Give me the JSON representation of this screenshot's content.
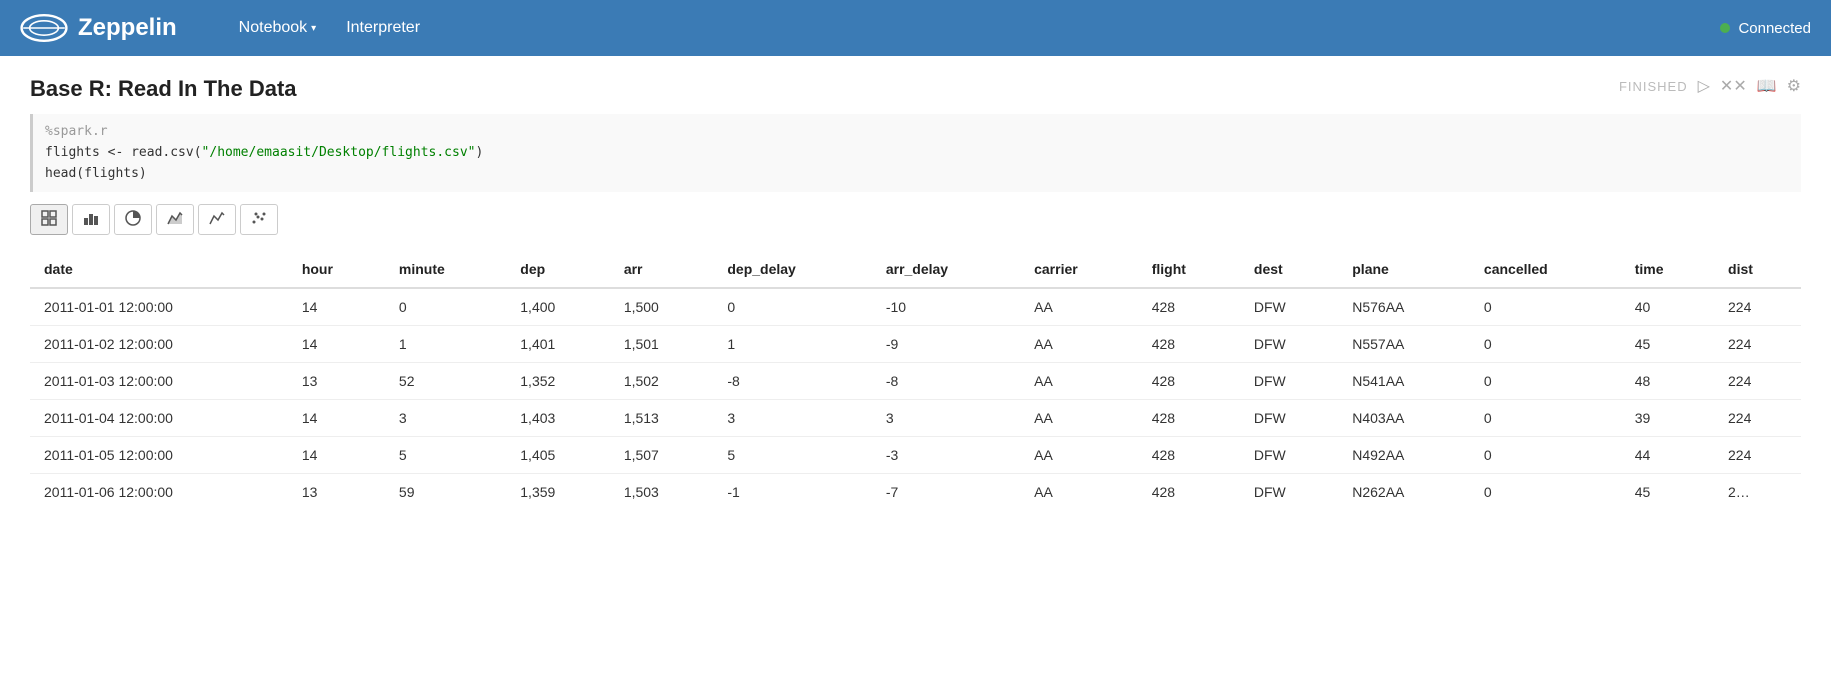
{
  "navbar": {
    "brand": "Zeppelin",
    "nav_items": [
      {
        "label": "Notebook",
        "has_dropdown": true
      },
      {
        "label": "Interpreter",
        "has_dropdown": false
      }
    ],
    "status_label": "Connected"
  },
  "notebook": {
    "title": "Base R: Read In The Data",
    "status": "FINISHED",
    "code_lines": [
      "%spark.r",
      "flights <- read.csv(\"/home/emaasit/Desktop/flights.csv\")",
      "head(flights)"
    ],
    "viz_buttons": [
      {
        "label": "⊞",
        "title": "table",
        "active": true
      },
      {
        "label": "▦",
        "title": "bar",
        "active": false
      },
      {
        "label": "◕",
        "title": "pie",
        "active": false
      },
      {
        "label": "▲",
        "title": "area",
        "active": false
      },
      {
        "label": "∿",
        "title": "line",
        "active": false
      },
      {
        "label": "⁙",
        "title": "scatter",
        "active": false
      }
    ],
    "table": {
      "columns": [
        "date",
        "hour",
        "minute",
        "dep",
        "arr",
        "dep_delay",
        "arr_delay",
        "carrier",
        "flight",
        "dest",
        "plane",
        "cancelled",
        "time",
        "dist"
      ],
      "rows": [
        [
          "2011-01-01 12:00:00",
          "14",
          "0",
          "1,400",
          "1,500",
          "0",
          "-10",
          "AA",
          "428",
          "DFW",
          "N576AA",
          "0",
          "40",
          "224"
        ],
        [
          "2011-01-02 12:00:00",
          "14",
          "1",
          "1,401",
          "1,501",
          "1",
          "-9",
          "AA",
          "428",
          "DFW",
          "N557AA",
          "0",
          "45",
          "224"
        ],
        [
          "2011-01-03 12:00:00",
          "13",
          "52",
          "1,352",
          "1,502",
          "-8",
          "-8",
          "AA",
          "428",
          "DFW",
          "N541AA",
          "0",
          "48",
          "224"
        ],
        [
          "2011-01-04 12:00:00",
          "14",
          "3",
          "1,403",
          "1,513",
          "3",
          "3",
          "AA",
          "428",
          "DFW",
          "N403AA",
          "0",
          "39",
          "224"
        ],
        [
          "2011-01-05 12:00:00",
          "14",
          "5",
          "1,405",
          "1,507",
          "5",
          "-3",
          "AA",
          "428",
          "DFW",
          "N492AA",
          "0",
          "44",
          "224"
        ],
        [
          "2011-01-06 12:00:00",
          "13",
          "59",
          "1,359",
          "1,503",
          "-1",
          "-7",
          "AA",
          "428",
          "DFW",
          "N262AA",
          "0",
          "45",
          "2…"
        ]
      ]
    }
  }
}
